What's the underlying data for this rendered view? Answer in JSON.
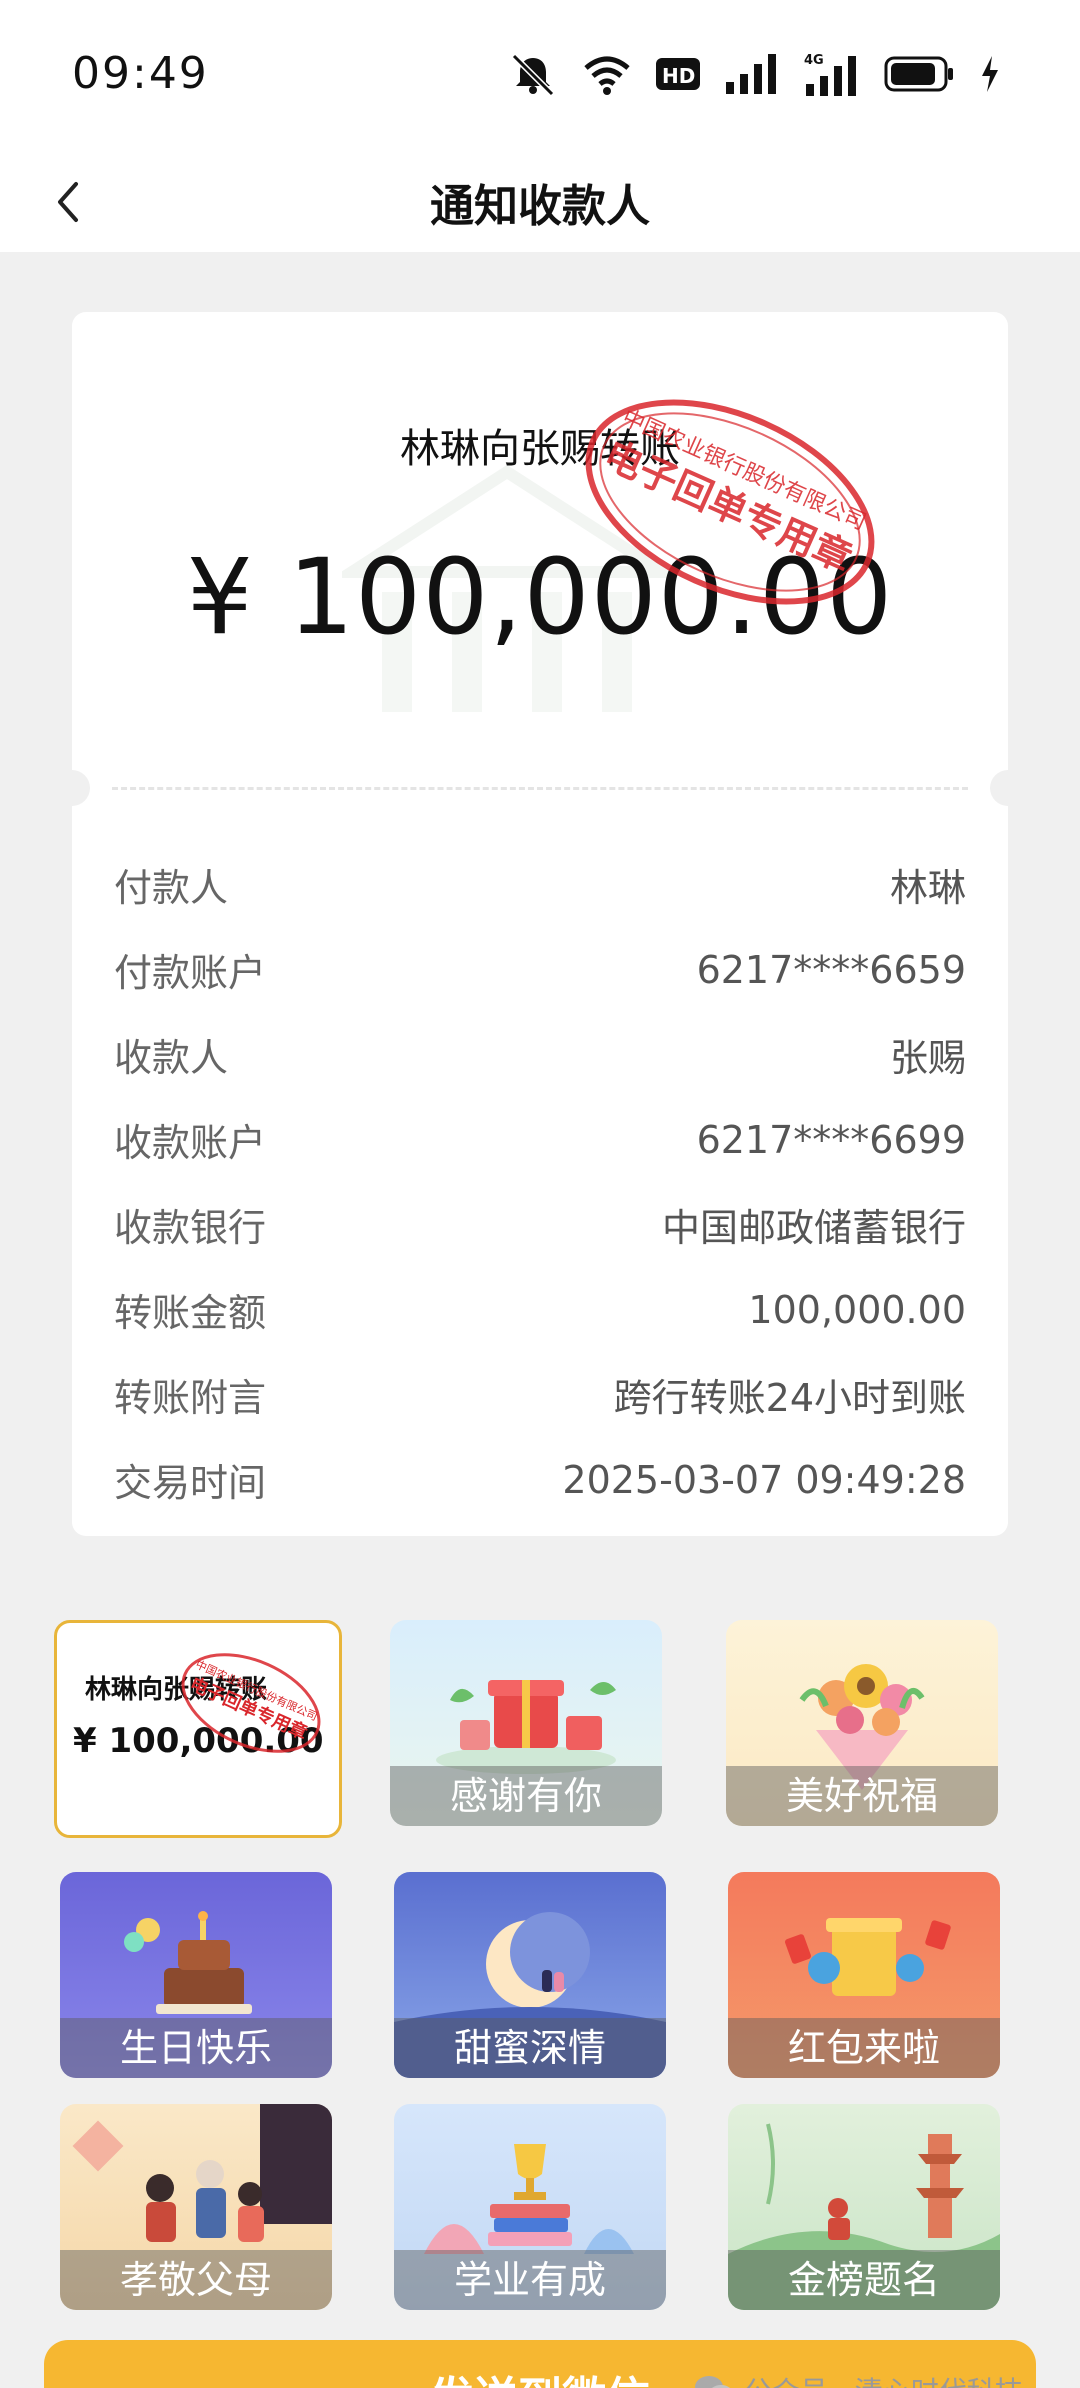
{
  "status": {
    "time": "09:49",
    "network": "4G",
    "hd": "HD"
  },
  "nav": {
    "title": "通知收款人"
  },
  "receipt": {
    "title": "林琳向张赐转账",
    "amount": "¥ 100,000.00",
    "seal_text": "中国农业银行股份有限公司 电子回单专用章",
    "rows": [
      {
        "label": "付款人",
        "value": "林琳"
      },
      {
        "label": "付款账户",
        "value": "6217****6659"
      },
      {
        "label": "收款人",
        "value": "张赐"
      },
      {
        "label": "收款账户",
        "value": "6217****6699"
      },
      {
        "label": "收款银行",
        "value": "中国邮政储蓄银行"
      },
      {
        "label": "转账金额",
        "value": "100,000.00"
      },
      {
        "label": "转账附言",
        "value": "跨行转账24小时到账"
      },
      {
        "label": "交易时间",
        "value": "2025-03-07 09:49:28"
      }
    ]
  },
  "templates": {
    "selected": {
      "title": "林琳向张赐转账",
      "amount": "¥ 100,000.00"
    },
    "items": [
      {
        "label": "感谢有你"
      },
      {
        "label": "美好祝福"
      },
      {
        "label": "生日快乐"
      },
      {
        "label": "甜蜜深情"
      },
      {
        "label": "红包来啦"
      },
      {
        "label": "孝敬父母"
      },
      {
        "label": "学业有成"
      },
      {
        "label": "金榜题名"
      }
    ]
  },
  "watermark": "公众号 · 清心时代科技",
  "send_button": {
    "label": "发送到微信"
  },
  "colors": {
    "accent": "#f6b731",
    "seal": "#d9262b",
    "selected_border": "#e8b53a"
  }
}
